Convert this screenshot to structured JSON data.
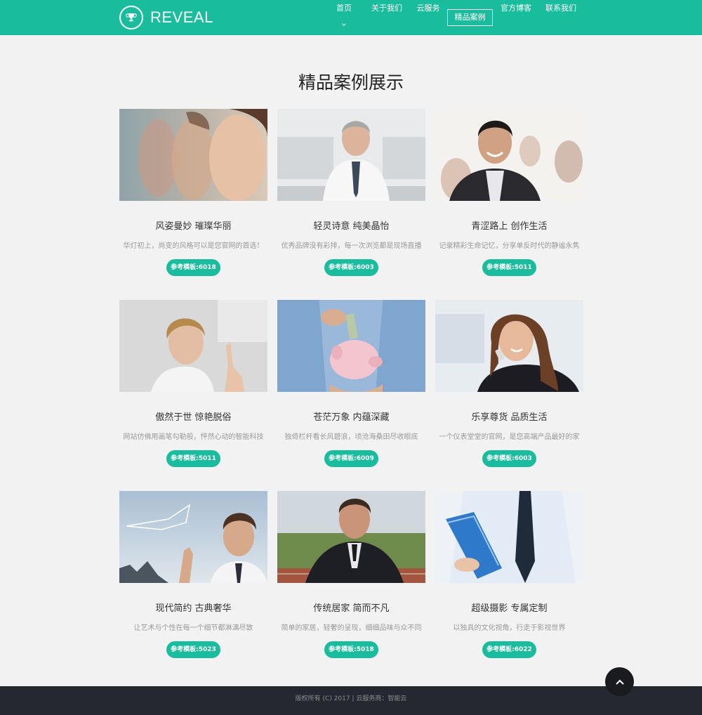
{
  "header": {
    "brand": "REVEAL",
    "nav": [
      {
        "label": "首页"
      },
      {
        "label": "关于我们"
      },
      {
        "label": "云服务"
      },
      {
        "label": "精品案例"
      },
      {
        "label": "官方博客"
      },
      {
        "label": "联系我们"
      }
    ]
  },
  "main": {
    "title": "精品案例展示",
    "cases": [
      {
        "title": "风姿曼妙 璀璨华丽",
        "desc": "华灯初上，尚变的风格可以是您官网的首选！",
        "button": "参考模板:6018"
      },
      {
        "title": "轻灵诗意 纯美晶怡",
        "desc": "优秀品牌没有彩排，每一次浏览都是现场直播",
        "button": "参考模板:6003"
      },
      {
        "title": "青涩路上 创作生活",
        "desc": "记录精彩生命记忆，分享单反时代的静谧永隽",
        "button": "参考模板:5011"
      },
      {
        "title": "傲然于世 惊艳脱俗",
        "desc": "网站仿佛用画笔勾勒般，怦然心动的智能科技",
        "button": "参考模板:5011"
      },
      {
        "title": "苍茫万象 内蕴深藏",
        "desc": "独倚栏杆看长风碧浪，顷沧海桑田尽收眼底",
        "button": "参考模板:6009"
      },
      {
        "title": "乐享尊货 品质生活",
        "desc": "一个仪表堂堂的官网，是您高端产品最好的家",
        "button": "参考模板:6003"
      },
      {
        "title": "现代简约 古典奢华",
        "desc": "让艺术与个性在每一个细节都淋漓尽致",
        "button": "参考模板:5023"
      },
      {
        "title": "传统居家 简而不凡",
        "desc": "简单的家居，轻奢的呈现，细细品味与众不同",
        "button": "参考模板:5018"
      },
      {
        "title": "超级摄影 专属定制",
        "desc": "以独具的文化视角，行走于影视世界",
        "button": "参考模板:6022"
      }
    ]
  },
  "footer": {
    "copyright": "版权所有 (C) 2017 | 云服务商：智能云"
  },
  "colors": {
    "accent": "#19bc9c",
    "footer_bg": "#252831",
    "page_bg": "#f2f2f2"
  },
  "icons": {
    "logo": "trophy-icon",
    "back_to_top": "chevron-up-icon"
  }
}
